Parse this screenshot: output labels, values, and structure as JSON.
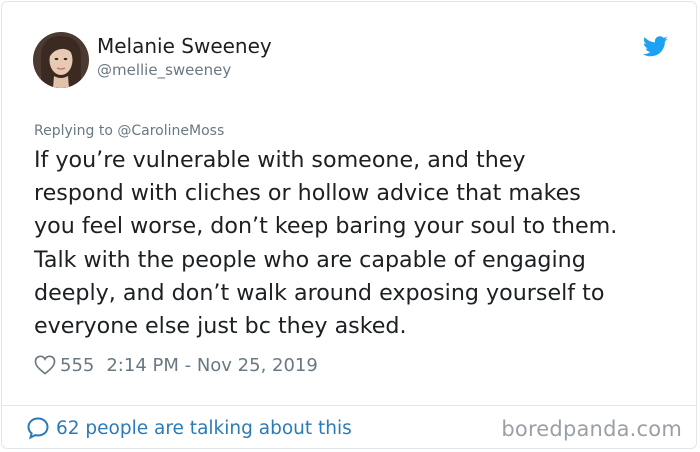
{
  "author": {
    "display_name": "Melanie Sweeney",
    "handle": "@mellie_sweeney"
  },
  "reply_context": "Replying to @CarolineMoss",
  "tweet": {
    "lines": [
      "If you’re vulnerable with someone, and they",
      "respond with cliches or hollow advice that makes",
      "you feel worse, don’t keep baring your soul to them.",
      "Talk with the people who are capable of engaging",
      "deeply, and don’t walk around exposing yourself to",
      "everyone else just bc they asked."
    ]
  },
  "meta": {
    "likes": "555",
    "timestamp": "2:14 PM - Nov 25, 2019"
  },
  "footer": {
    "talking": "62 people are talking about this"
  },
  "watermark": "boredpanda.com",
  "icons": {
    "brand": "twitter-bird-icon",
    "like": "heart-icon",
    "comments": "speech-bubble-icon"
  },
  "colors": {
    "twitter_blue": "#1da1f2",
    "link_blue": "#2b7bb9",
    "muted": "#697882",
    "text": "#1c2022"
  }
}
